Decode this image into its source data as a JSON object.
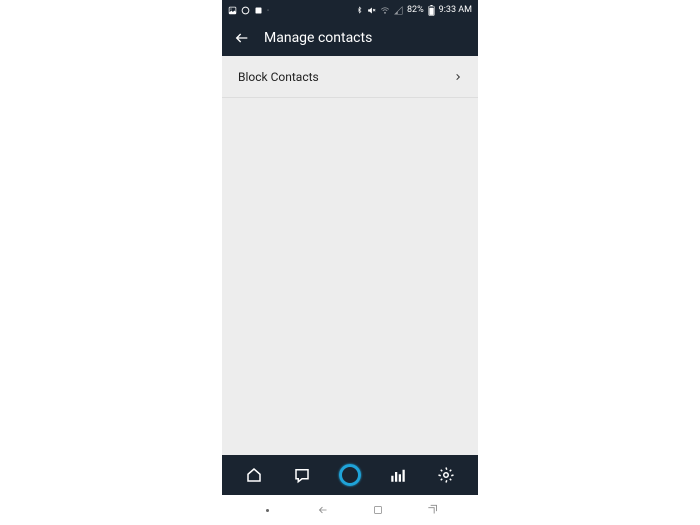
{
  "status": {
    "battery": "82%",
    "time": "9:33 AM"
  },
  "header": {
    "title": "Manage contacts"
  },
  "list": {
    "items": [
      {
        "label": "Block Contacts"
      }
    ]
  }
}
